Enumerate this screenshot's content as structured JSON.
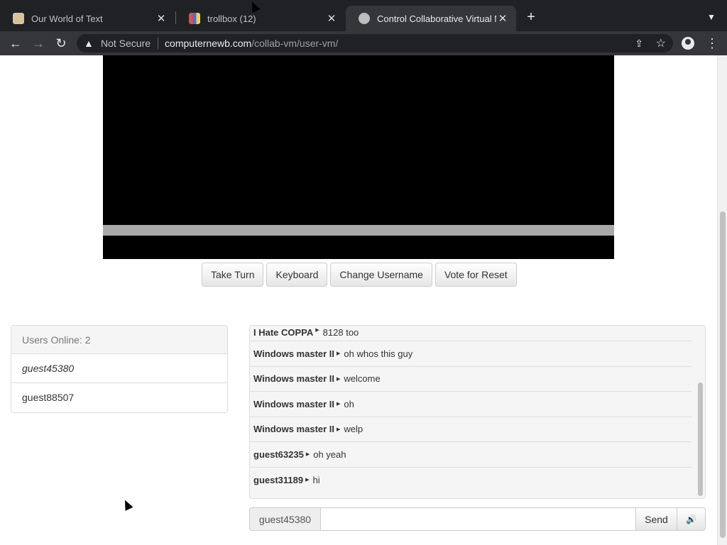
{
  "browser": {
    "tabs": [
      {
        "title": "Our World of Text",
        "favicon_color": "#d7c39a",
        "active": false
      },
      {
        "title": "trollbox (12)",
        "favicon_color": "#4a6fd8",
        "active": false
      },
      {
        "title": "Control Collaborative Virtual M",
        "favicon_color": "#bdbdbd",
        "active": true
      }
    ],
    "security_label": "Not Secure",
    "url_host": "computernewb.com",
    "url_path": "/collab-vm/user-vm/"
  },
  "vm": {
    "buttons": {
      "take_turn": "Take Turn",
      "keyboard": "Keyboard",
      "change_username": "Change Username",
      "vote_reset": "Vote for Reset"
    }
  },
  "users": {
    "heading": "Users Online: 2",
    "list": [
      "guest45380",
      "guest88507"
    ]
  },
  "chat": {
    "messages": [
      {
        "user": "I Hate COPPA",
        "text": "8128 too"
      },
      {
        "user": "Windows master II",
        "text": "oh whos this guy"
      },
      {
        "user": "Windows master II",
        "text": "welcome"
      },
      {
        "user": "Windows master II",
        "text": "oh"
      },
      {
        "user": "Windows master II",
        "text": "welp"
      },
      {
        "user": "guest63235",
        "text": "oh yeah"
      },
      {
        "user": "guest31189",
        "text": "hi"
      }
    ],
    "username": "guest45380",
    "input_value": "",
    "send_label": "Send"
  }
}
